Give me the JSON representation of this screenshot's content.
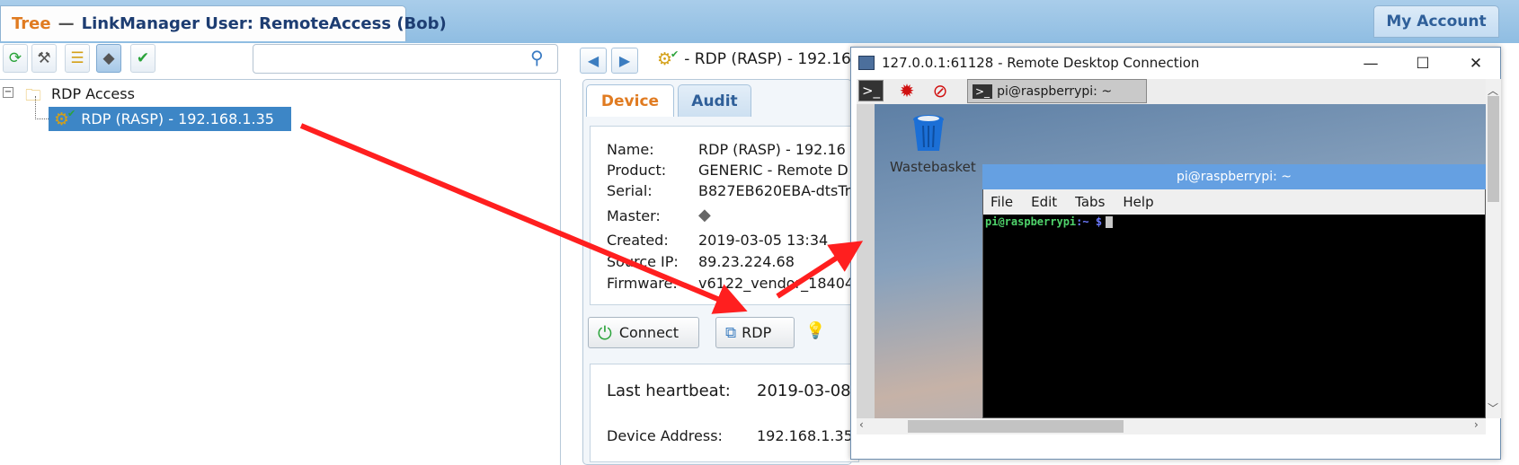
{
  "header": {
    "tree_label": "Tree",
    "separator": "—",
    "title": "LinkManager User: RemoteAccess (Bob)",
    "my_account": "My Account"
  },
  "toolbar": {
    "icons": [
      "refresh-icon",
      "hammer-icon",
      "tree-structure-icon",
      "device-icon",
      "device-check-icon"
    ],
    "search_placeholder": ""
  },
  "tree": {
    "root_label": "RDP Access",
    "expander": "−",
    "selected_item": "RDP (RASP) - 192.168.1.35"
  },
  "device_panel": {
    "header_title": "- RDP (RASP) - 192.16",
    "tabs": [
      "Device",
      "Audit"
    ],
    "fields": [
      {
        "label": "Name:",
        "value": "RDP (RASP) - 192.16"
      },
      {
        "label": "Product:",
        "value": "GENERIC - Remote D"
      },
      {
        "label": "Serial:",
        "value": "B827EB620EBA-dtsTr"
      },
      {
        "label": "Master:",
        "value": ""
      },
      {
        "label": "Created:",
        "value": "2019-03-05 13:34"
      },
      {
        "label": "Source IP:",
        "value": "89.23.224.68"
      },
      {
        "label": "Firmware:",
        "value": "v6122_vendor_18404"
      }
    ],
    "connect_label": "Connect",
    "rdp_label": "RDP",
    "heartbeat_label": "Last heartbeat:",
    "heartbeat_value": "2019-03-08",
    "device_address_label": "Device Address:",
    "device_address_value": "192.168.1.35"
  },
  "rdp_window": {
    "title": "127.0.0.1:61128 - Remote Desktop Connection",
    "minimize": "—",
    "maximize": "☐",
    "close": "✕",
    "taskbar_tab": "pi@raspberrypi: ~",
    "wastebasket_label": "Wastebasket",
    "terminal_title": "pi@raspberrypi: ~",
    "terminal_menu": [
      "File",
      "Edit",
      "Tabs",
      "Help"
    ],
    "prompt_user": "pi@raspberrypi",
    "prompt_path": ":~",
    "prompt_symbol": "$"
  },
  "colors": {
    "tree_orange": "#e07b21",
    "selection_blue": "#3d86c6",
    "annotation_arrow": "#ff1f1f"
  }
}
